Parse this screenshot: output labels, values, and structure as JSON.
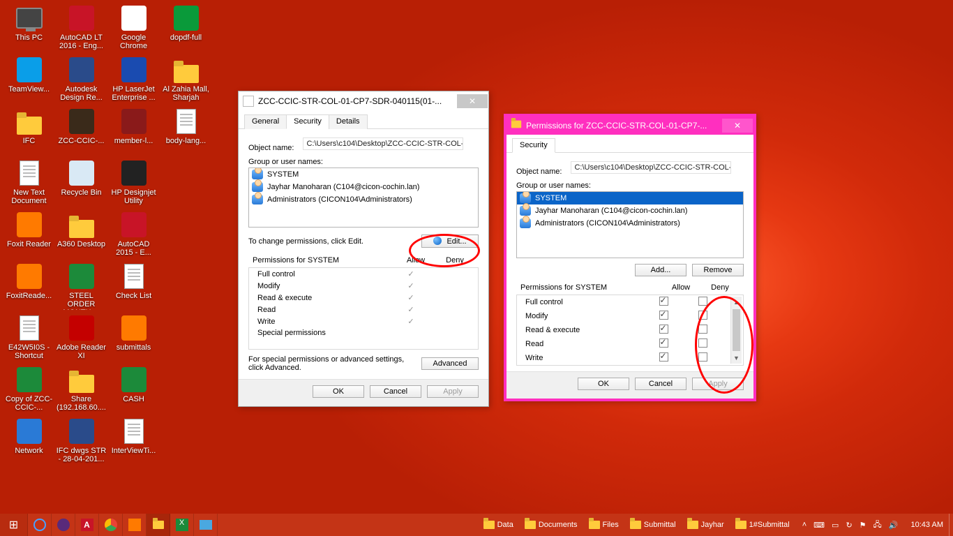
{
  "desktop_icons": [
    {
      "label": "This PC",
      "type": "pc"
    },
    {
      "label": "TeamView...",
      "type": "app",
      "bg": "#0a9ee8"
    },
    {
      "label": "IFC",
      "type": "folder"
    },
    {
      "label": "New Text Document",
      "type": "doc"
    },
    {
      "label": "Foxit Reader",
      "type": "app",
      "bg": "#ff7a00"
    },
    {
      "label": "FoxitReade...",
      "type": "app",
      "bg": "#ff7a00"
    },
    {
      "label": "E42W5I0S - Shortcut",
      "type": "doc"
    },
    {
      "label": "Copy of ZCC-CCIC-...",
      "type": "app",
      "bg": "#1c8a3a"
    },
    {
      "label": "Network",
      "type": "app",
      "bg": "#2a7ad6"
    },
    {
      "label": "AutoCAD LT 2016 - Eng...",
      "type": "app",
      "bg": "#c81427"
    },
    {
      "label": "Autodesk Design Re...",
      "type": "app",
      "bg": "#2a4b8a"
    },
    {
      "label": "ZCC-CCIC-...",
      "type": "app",
      "bg": "#3a2a1a"
    },
    {
      "label": "Recycle Bin",
      "type": "app",
      "bg": "#d9e9f5"
    },
    {
      "label": "A360 Desktop",
      "type": "folder"
    },
    {
      "label": "STEEL ORDER MONTH ...",
      "type": "app",
      "bg": "#1c8a3a"
    },
    {
      "label": "Adobe Reader XI",
      "type": "app",
      "bg": "#c40000"
    },
    {
      "label": "Share (192.168.60....",
      "type": "folder"
    },
    {
      "label": "IFC dwgs STR - 28-04-201...",
      "type": "app",
      "bg": "#2a4b8a"
    },
    {
      "label": "Google Chrome",
      "type": "app",
      "bg": "#ffffff"
    },
    {
      "label": "HP LaserJet Enterprise ...",
      "type": "app",
      "bg": "#1a4bb0"
    },
    {
      "label": "member-l...",
      "type": "app",
      "bg": "#8a1a1a"
    },
    {
      "label": "HP Designjet Utility",
      "type": "app",
      "bg": "#222"
    },
    {
      "label": "AutoCAD 2015 - E...",
      "type": "app",
      "bg": "#c81427"
    },
    {
      "label": "Check List",
      "type": "doc"
    },
    {
      "label": "submittals",
      "type": "app",
      "bg": "#ff7a00"
    },
    {
      "label": "CASH",
      "type": "app",
      "bg": "#1c8a3a"
    },
    {
      "label": "InterViewTi...",
      "type": "doc"
    },
    {
      "label": "dopdf-full",
      "type": "app",
      "bg": "#0a9a3a"
    },
    {
      "label": "Al Zahia Mall, Sharjah",
      "type": "folder"
    },
    {
      "label": "body-lang...",
      "type": "doc"
    }
  ],
  "dialog1": {
    "title": "ZCC-CCIC-STR-COL-01-CP7-SDR-040115(01-...",
    "tabs": [
      "General",
      "Security",
      "Details"
    ],
    "active_tab": 1,
    "object_name_label": "Object name:",
    "object_path": "C:\\Users\\c104\\Desktop\\ZCC-CCIC-STR-COL-01-C",
    "group_label": "Group or user names:",
    "users": [
      "SYSTEM",
      "Jayhar Manoharan (C104@cicon-cochin.lan)",
      "Administrators (CICON104\\Administrators)"
    ],
    "edit_hint": "To change permissions, click Edit.",
    "edit_btn": "Edit...",
    "perm_title": "Permissions for SYSTEM",
    "allow": "Allow",
    "deny": "Deny",
    "perms": [
      "Full control",
      "Modify",
      "Read & execute",
      "Read",
      "Write",
      "Special permissions"
    ],
    "perm_checks": [
      true,
      true,
      true,
      true,
      true,
      false
    ],
    "adv_hint": "For special permissions or advanced settings, click Advanced.",
    "adv_btn": "Advanced",
    "ok": "OK",
    "cancel": "Cancel",
    "apply": "Apply"
  },
  "dialog2": {
    "title": "Permissions for ZCC-CCIC-STR-COL-01-CP7-...",
    "tab": "Security",
    "object_name_label": "Object name:",
    "object_path": "C:\\Users\\c104\\Desktop\\ZCC-CCIC-STR-COL-01-C",
    "group_label": "Group or user names:",
    "users": [
      "SYSTEM",
      "Jayhar Manoharan (C104@cicon-cochin.lan)",
      "Administrators (CICON104\\Administrators)"
    ],
    "selected_user": 0,
    "add_btn": "Add...",
    "remove_btn": "Remove",
    "perm_title": "Permissions for SYSTEM",
    "allow": "Allow",
    "deny": "Deny",
    "perms": [
      "Full control",
      "Modify",
      "Read & execute",
      "Read",
      "Write"
    ],
    "allow_checks": [
      true,
      true,
      true,
      true,
      true
    ],
    "deny_checks": [
      false,
      false,
      false,
      false,
      false
    ],
    "ok": "OK",
    "cancel": "Cancel",
    "apply": "Apply"
  },
  "taskbar": {
    "pinned_folders": [
      "Data",
      "Documents",
      "Files",
      "Submittal",
      "Jayhar",
      "1#Submittal"
    ],
    "clock": "10:43 AM"
  }
}
